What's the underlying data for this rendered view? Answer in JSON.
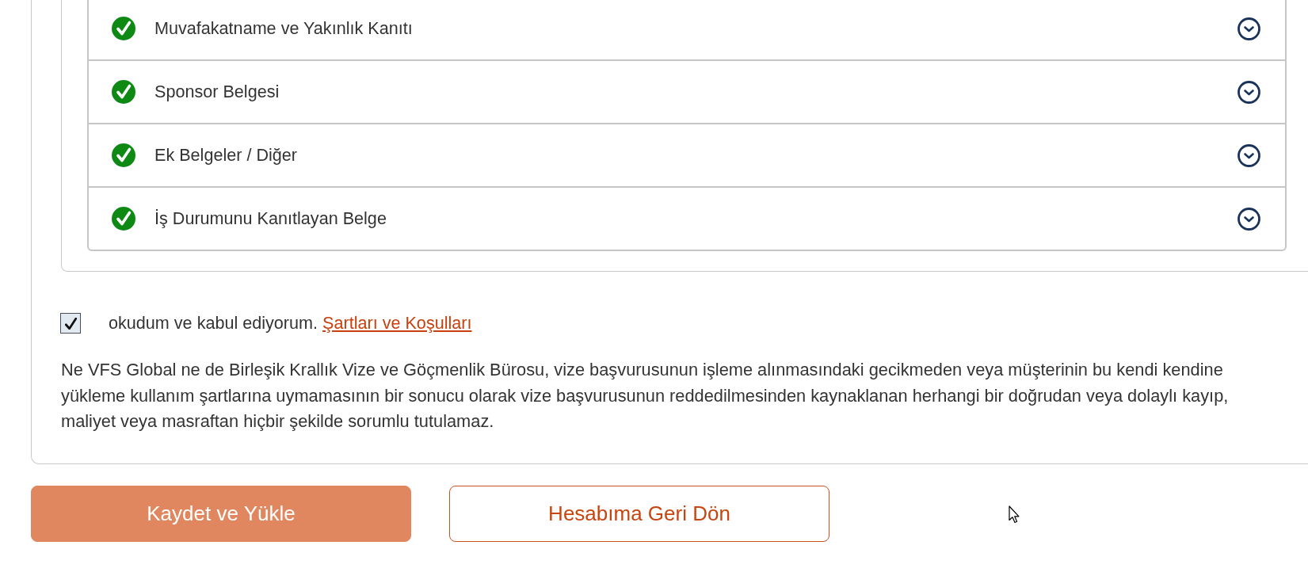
{
  "documents": [
    {
      "label": "Muvafakatname ve Yakınlık Kanıtı",
      "completed": true,
      "expanded": false
    },
    {
      "label": "Sponsor Belgesi",
      "completed": true,
      "expanded": false
    },
    {
      "label": "Ek Belgeler / Diğer",
      "completed": true,
      "expanded": false
    },
    {
      "label": "İş Durumunu Kanıtlayan Belge",
      "completed": true,
      "expanded": false
    }
  ],
  "consent": {
    "checked": true,
    "text": "okudum ve kabul ediyorum.",
    "link": "Şartları ve Koşulları"
  },
  "disclaimer": "Ne VFS Global ne de Birleşik Krallık Vize ve Göçmenlik Bürosu, vize başvurusunun işleme alınmasındaki gecikmeden veya müşterinin bu kendi kendine yükleme kullanım şartlarına uymamasının bir sonucu olarak vize başvurusunun reddedilmesinden kaynaklanan herhangi bir doğrudan veya dolaylı kayıp, maliyet veya masraftan hiçbir şekilde sorumlu tutulamaz.",
  "buttons": [
    {
      "label": "Kaydet ve Yükle",
      "kind": "primary"
    },
    {
      "label": "Hesabıma Geri Dön",
      "kind": "secondary"
    }
  ]
}
